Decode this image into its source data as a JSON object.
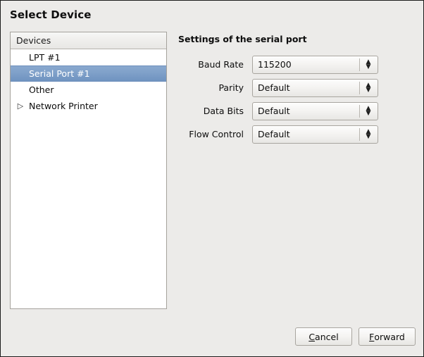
{
  "window": {
    "title": "Select Device",
    "background_color": "#ecebe9",
    "border_color": "#1c1c1c"
  },
  "device_list": {
    "header": "Devices",
    "selected_index": 1,
    "items": [
      {
        "label": "LPT #1",
        "expander": "",
        "selected": false
      },
      {
        "label": "Serial Port #1",
        "expander": "",
        "selected": true
      },
      {
        "label": "Other",
        "expander": "",
        "selected": false
      },
      {
        "label": "Network Printer",
        "expander": "▷",
        "selected": false
      }
    ],
    "selection_color": "#7fa0c9"
  },
  "settings": {
    "heading": "Settings of the serial port",
    "fields": [
      {
        "label": "Baud Rate",
        "value": "115200"
      },
      {
        "label": "Parity",
        "value": "Default"
      },
      {
        "label": "Data Bits",
        "value": "Default"
      },
      {
        "label": "Flow Control",
        "value": "Default"
      }
    ],
    "arrow_up_icon": "▲",
    "arrow_down_icon": "▼"
  },
  "buttons": {
    "cancel": {
      "mnemonic": "C",
      "rest": "ancel"
    },
    "forward": {
      "mnemonic": "F",
      "rest": "orward"
    }
  }
}
